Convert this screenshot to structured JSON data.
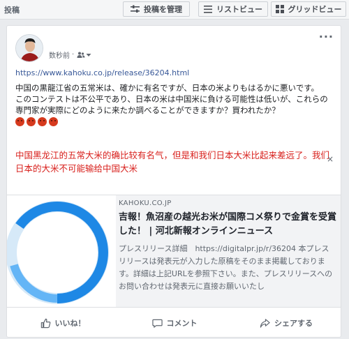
{
  "topbar": {
    "page_label": "投稿",
    "manage_label": "投稿を管理",
    "list_view_label": "リストビュー",
    "grid_view_label": "グリッドビュー"
  },
  "post": {
    "timestamp": "数秒前",
    "dot": "·",
    "url": "https://www.kahoku.co.jp/release/36204.html",
    "body_line1": "中国の黒龍江省の五常米は、確かに有名ですが、日本の米よりもはるかに悪いです。",
    "body_line2": "このコンテストは不公平であり、日本の米は中国米に負ける可能性は低いが、これらの専門家が実際にどのように来たか調べることができますか？買われたか？",
    "translation": "中国黑龙江的五常大米的确比较有名气，但是和我们日本大米比起来差远了。我们日本的大米不可能输给中国大米",
    "more_dots": "···",
    "card_more": "×"
  },
  "link_preview": {
    "domain": "KAHOKU.CO.JP",
    "title": "吉報！魚沼産の越光お米が国際コメ祭りで金賞を受賞した！ | 河北新報オンラインニュース",
    "description": "プレスリリース詳細　https://digitalpr.jp/r/36204 本プレスリリースは発表元が入力した原稿をそのまま掲載しております。詳細は上記URLを参照下さい。また、プレスリリースへのお問い合わせは発表元に直接お願いいたし"
  },
  "actions": {
    "like": "いいね！",
    "comment": "コメント",
    "share": "シェアする"
  },
  "colors": {
    "link": "#385898",
    "translation": "#d8201c",
    "ring": "#1e88e5"
  }
}
